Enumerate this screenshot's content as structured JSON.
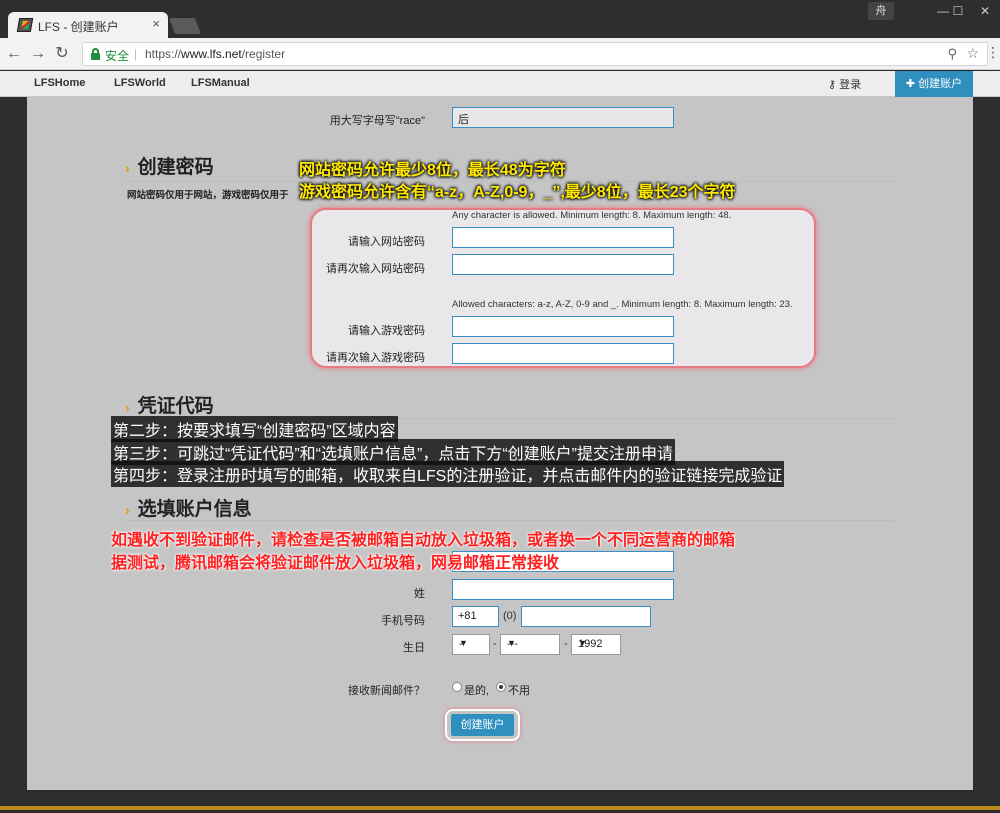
{
  "browser": {
    "tab_title": "LFS - 创建账户",
    "close_glyph": "×",
    "profile_label": "舟",
    "secure_label": "安全",
    "url_prefix": "https://",
    "url_host": "www.lfs.net",
    "url_path": "/register"
  },
  "site_nav": {
    "links": [
      "LFSHome",
      "LFSWorld",
      "LFSManual"
    ],
    "login": "登录",
    "create_account": "创建账户"
  },
  "form": {
    "race_label": "用大写字母写\"race\"",
    "race_value": "后",
    "password_section": {
      "title": "创建密码",
      "note": "网站密码仅用于网站，游戏密码仅用于",
      "web_hint": "Any character is allowed. Minimum length: 8. Maximum length: 48.",
      "web_pw_label": "请输入网站密码",
      "web_pw_confirm_label": "请再次输入网站密码",
      "game_hint": "Allowed characters: a-z, A-Z, 0-9 and _. Minimum length: 8. Maximum length: 23.",
      "game_pw_label": "请输入游戏密码",
      "game_pw_confirm_label": "请再次输入游戏密码"
    },
    "voucher_section": {
      "title": "凭证代码"
    },
    "optional_section": {
      "title": "选填账户信息",
      "surname_label": "姓",
      "phone_label": "手机号码",
      "phone_code": "+81",
      "phone_paren": "(0)",
      "birthday_label": "生日",
      "day_value": "-",
      "month_value": "---",
      "year_value": "1992",
      "newsletter_label": "接收新闻邮件？",
      "newsletter_yes": "是的,",
      "newsletter_no": "不用"
    },
    "submit_label": "创建账户"
  },
  "annotations": {
    "yellow_line1": "网站密码允许最少8位，最长48为字符",
    "yellow_line2": "游戏密码允许含有“a-z，A-Z,0-9，_”,最少8位，最长23个字符",
    "white_line1": "第二步：按要求填写“创建密码”区域内容",
    "white_line2": "第三步：可跳过“凭证代码”和“选填账户信息”，点击下方“创建账户”提交注册申请",
    "white_line3": "第四步：登录注册时填写的邮箱，收取来自LFS的注册验证，并点击邮件内的验证链接完成验证",
    "red_line1": "如遇收不到验证邮件，请检查是否被邮箱自动放入垃圾箱，或者换一个不同运营商的邮箱",
    "red_line2": "据测试，腾讯邮箱会将验证邮件放入垃圾箱，网易邮箱正常接收"
  },
  "colors": {
    "accent_blue": "#2f8fbf",
    "highlight_border": "#e87a85",
    "annotation_yellow": "#ffe800",
    "annotation_red": "#ff2020"
  }
}
